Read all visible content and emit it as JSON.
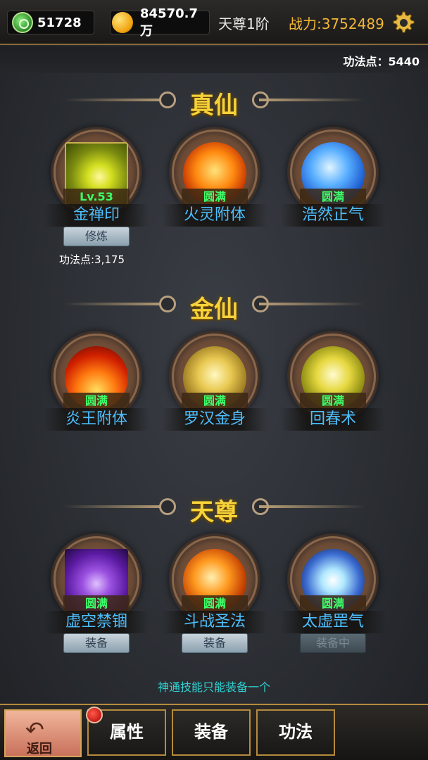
{
  "header": {
    "jade": "51728",
    "gold": "84570.7万",
    "rank": "天尊1阶",
    "power": "战力:3752489",
    "gongfa_points": "功法点：5440"
  },
  "sections": [
    {
      "title": "真仙",
      "skills": [
        {
          "name": "金禅印",
          "badge": "Lv.53",
          "button": "修炼",
          "cost": "功法点:3,175"
        },
        {
          "name": "火灵附体",
          "badge": "圆满"
        },
        {
          "name": "浩然正气",
          "badge": "圆满"
        }
      ]
    },
    {
      "title": "金仙",
      "skills": [
        {
          "name": "炎王附体",
          "badge": "圆满"
        },
        {
          "name": "罗汉金身",
          "badge": "圆满"
        },
        {
          "name": "回春术",
          "badge": "圆满"
        }
      ]
    },
    {
      "title": "天尊",
      "skills": [
        {
          "name": "虚空禁锢",
          "badge": "圆满",
          "button": "装备"
        },
        {
          "name": "斗战圣法",
          "badge": "圆满",
          "button": "装备"
        },
        {
          "name": "太虚罡气",
          "badge": "圆满",
          "button": "装备中"
        }
      ]
    }
  ],
  "note": "神通技能只能装备一个",
  "bottom": {
    "back_label": "返回",
    "tabs": [
      "属性",
      "装备",
      "功法"
    ]
  },
  "icons": {
    "jade": "jade-currency-icon",
    "gold": "gold-coin-icon",
    "settings": "gear-icon",
    "back": "return-arrow-icon",
    "notify": "red-dot-icon"
  },
  "colors": {
    "power": "#f1b637",
    "section_title": "#f6d23a",
    "skill_name": "#4cc0ff",
    "badge": "#3dff6a",
    "note": "#2fd2d2"
  }
}
